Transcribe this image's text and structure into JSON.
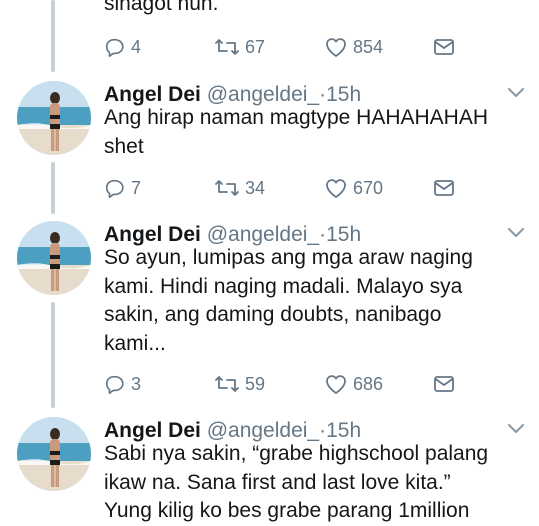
{
  "colors": {
    "text": "#14171a",
    "secondary": "#657786",
    "thread_line": "#c4cfd6",
    "icon": "#657786"
  },
  "top_fragment": {
    "text": "sinagot nun.",
    "actions": {
      "replies": "4",
      "retweets": "67",
      "likes": "854"
    }
  },
  "tweets": [
    {
      "name": "Angel Dei",
      "handle": "@angeldei_",
      "separator": "·",
      "time": "15h",
      "text": "Ang hirap naman magtype HAHAHAHAH\nshet",
      "actions": {
        "replies": "7",
        "retweets": "34",
        "likes": "670"
      }
    },
    {
      "name": "Angel Dei",
      "handle": "@angeldei_",
      "separator": "·",
      "time": "15h",
      "text": "So ayun, lumipas ang mga araw naging\nkami. Hindi naging madali. Malayo sya\nsakin, ang daming doubts, nanibago\nkami...",
      "actions": {
        "replies": "3",
        "retweets": "59",
        "likes": "686"
      }
    },
    {
      "name": "Angel Dei",
      "handle": "@angeldei_",
      "separator": "·",
      "time": "15h",
      "text": "Sabi nya sakin, “grabe highschool palang\nikaw na. Sana first and last love kita.”\nYung kilig ko bes grabe parang 1million"
    }
  ],
  "icons": {
    "reply": "reply-icon",
    "retweet": "retweet-icon",
    "like": "heart-icon",
    "message": "envelope-icon",
    "more": "chevron-down-icon"
  }
}
